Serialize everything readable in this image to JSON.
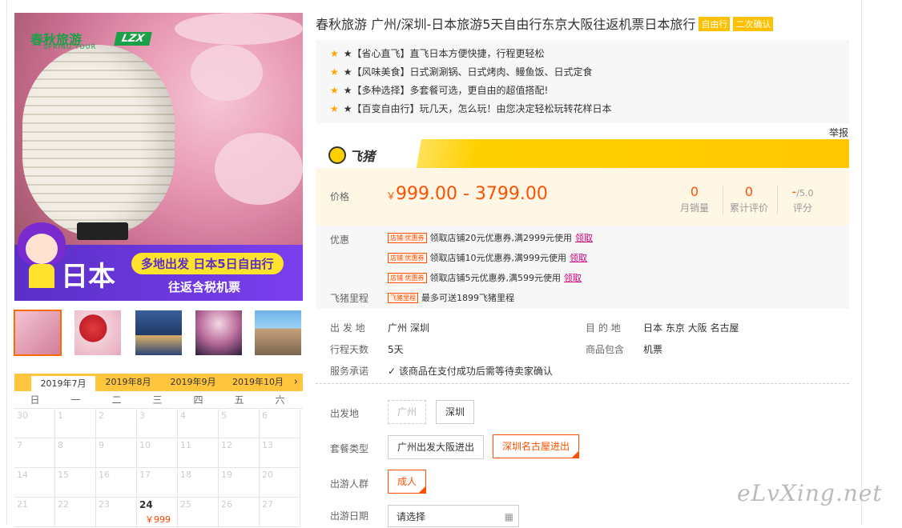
{
  "main_image": {
    "brand": "春秋旅游",
    "brand_sub": "SPRING TOUR",
    "badge": "LZX",
    "banner_big": "日本",
    "banner_pill": "多地出发 日本5日自由行",
    "banner_sub": "往返含税机票"
  },
  "thumbnails": [
    "lantern",
    "umbrella",
    "city-night",
    "sakura-night",
    "street"
  ],
  "calendar": {
    "months": [
      "2019年7月",
      "2019年8月",
      "2019年9月",
      "2019年10月"
    ],
    "active_month": 0,
    "next": "›",
    "weekdays": [
      "日",
      "一",
      "二",
      "三",
      "四",
      "五",
      "六"
    ],
    "days": [
      [
        "30",
        "1",
        "2",
        "3",
        "4",
        "5",
        "6"
      ],
      [
        "7",
        "8",
        "9",
        "10",
        "11",
        "12",
        "13"
      ],
      [
        "14",
        "15",
        "16",
        "17",
        "18",
        "19",
        "20"
      ],
      [
        "21",
        "22",
        "23",
        "24",
        "25",
        "26",
        "27"
      ]
    ],
    "available": {
      "day": "24",
      "price": "￥999"
    }
  },
  "product": {
    "title": "春秋旅游 广州/深圳-日本旅游5天自由行东京大阪往返机票日本旅行",
    "tags": [
      "自由行",
      "二次确认"
    ],
    "highlights": [
      "★【省心直飞】直飞日本方便快捷，行程更轻松",
      "★【风味美食】日式涮涮锅、日式烤肉、鳗鱼饭、日式定食",
      "★【多种选择】多套餐可选，更自由的超值搭配!",
      "★【百变自由行】玩几天，怎么玩！由您决定轻松玩转花样日本"
    ],
    "report": "举报"
  },
  "fliggy": {
    "logo": "飞猪"
  },
  "price": {
    "label": "价格",
    "currency": "￥",
    "range": "999.00 - 3799.00",
    "stats": [
      {
        "value": "0",
        "label": "月销量"
      },
      {
        "value": "0",
        "label": "累计评价"
      },
      {
        "value": "-",
        "suffix": "/5.0",
        "label": "评分"
      }
    ]
  },
  "promo": {
    "label": "优惠",
    "coupon_tag": "店铺 优惠券",
    "coupons": [
      "领取店铺20元优惠券,满2999元使用",
      "领取店铺10元优惠券,满999元使用",
      "领取店铺5元优惠券,满599元使用"
    ],
    "claim": "领取",
    "miles_label": "飞猪里程",
    "miles_tag": "飞猪里程",
    "miles_text": "最多可送1899飞猪里程"
  },
  "info": {
    "from_label": "出 发 地",
    "from_value": "广州  深圳",
    "dest_label": "目 的 地",
    "dest_value": "日本  东京  大阪  名古屋",
    "days_label": "行程天数",
    "days_value": "5天",
    "includes_label": "商品包含",
    "includes_value": "机票",
    "service_label": "服务承诺",
    "service_value": "该商品在支付成功后需等待卖家确认"
  },
  "options": {
    "departure_label": "出发地",
    "departures": [
      "广州",
      "深圳"
    ],
    "package_label": "套餐类型",
    "packages": [
      "广州出发大阪进出",
      "深圳名古屋进出"
    ],
    "crowd_label": "出游人群",
    "crowds": [
      "成人"
    ],
    "date_label": "出游日期",
    "date_placeholder": "请选择"
  },
  "watermark": "eLvXing.net"
}
